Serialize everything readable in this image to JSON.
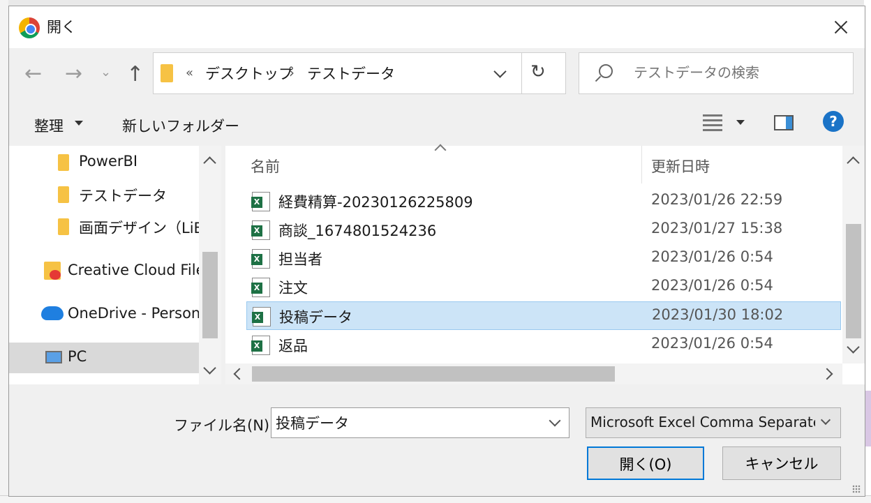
{
  "window": {
    "title": "開く"
  },
  "navigation": {
    "breadcrumb_overflow": "«",
    "breadcrumbs": [
      {
        "label": "デスクトップ"
      },
      {
        "label": "テストデータ"
      }
    ],
    "separator": "›"
  },
  "search": {
    "placeholder": "テストデータの検索"
  },
  "toolbar": {
    "organize": "整理",
    "new_folder": "新しいフォルダー",
    "help": "?"
  },
  "nav_pane": {
    "items": [
      {
        "label": "PowerBI",
        "icon": "folder-icon"
      },
      {
        "label": "テストデータ",
        "icon": "folder-icon"
      },
      {
        "label": "画面デザイン（LiB",
        "icon": "folder-icon"
      },
      {
        "label": "Creative Cloud File",
        "icon": "creative-cloud-folder-icon"
      },
      {
        "label": "OneDrive - Person",
        "icon": "onedrive-icon"
      },
      {
        "label": "PC",
        "icon": "pc-icon",
        "selected": true
      }
    ]
  },
  "file_list": {
    "columns": {
      "name": "名前",
      "date": "更新日時"
    },
    "files": [
      {
        "name": "経費精算-20230126225809",
        "date": "2023/01/26 22:59",
        "icon": "excel-file-icon"
      },
      {
        "name": "商談_1674801524236",
        "date": "2023/01/27 15:38",
        "icon": "excel-file-icon"
      },
      {
        "name": "担当者",
        "date": "2023/01/26 0:54",
        "icon": "excel-file-icon"
      },
      {
        "name": "注文",
        "date": "2023/01/26 0:54",
        "icon": "excel-file-icon"
      },
      {
        "name": "投稿データ",
        "date": "2023/01/30 18:02",
        "icon": "excel-file-icon",
        "selected": true
      },
      {
        "name": "返品",
        "date": "2023/01/26 0:54",
        "icon": "excel-file-icon"
      }
    ]
  },
  "footer": {
    "filename_label": "ファイル名(N):",
    "filename_value": "投稿データ",
    "filetype": "Microsoft Excel Comma Separated Values File",
    "open_button": "開く(O)",
    "cancel_button": "キャンセル"
  },
  "colors": {
    "selection": "#cce4f7",
    "accent": "#0078d7",
    "excel": "#1e7145"
  }
}
